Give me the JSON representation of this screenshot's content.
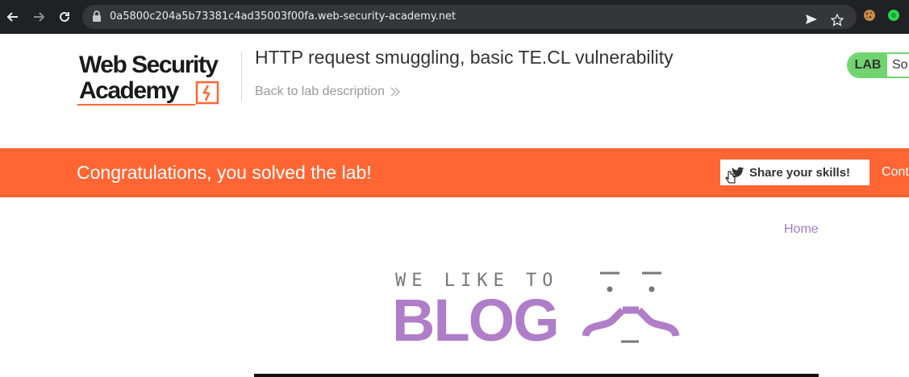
{
  "browser": {
    "url": "0a5800c204a5b73381c4ad35003f00fa.web-security-academy.net",
    "icons": [
      "back-arrow-icon",
      "forward-arrow-icon",
      "reload-icon",
      "lock-icon",
      "send-icon",
      "star-icon",
      "cookie-icon",
      "extension-icon"
    ]
  },
  "header": {
    "logo_line1": "Web Security",
    "logo_line2": "Academy",
    "lab_title": "HTTP request smuggling, basic TE.CL vulnerability",
    "back_link": "Back to lab description",
    "badge_label": "LAB",
    "badge_status": "So"
  },
  "banner": {
    "message": "Congratulations, you solved the lab!",
    "share_label": "Share your skills!",
    "continue_label": "Cont"
  },
  "blog": {
    "nav_home": "Home",
    "logo_small": "WE LIKE TO",
    "logo_big": "BLOG"
  },
  "colors": {
    "browser_bg": "#202124",
    "banner": "#ff6633",
    "accent_purple": "#b07dc9",
    "lab_green": "#70d46f"
  }
}
